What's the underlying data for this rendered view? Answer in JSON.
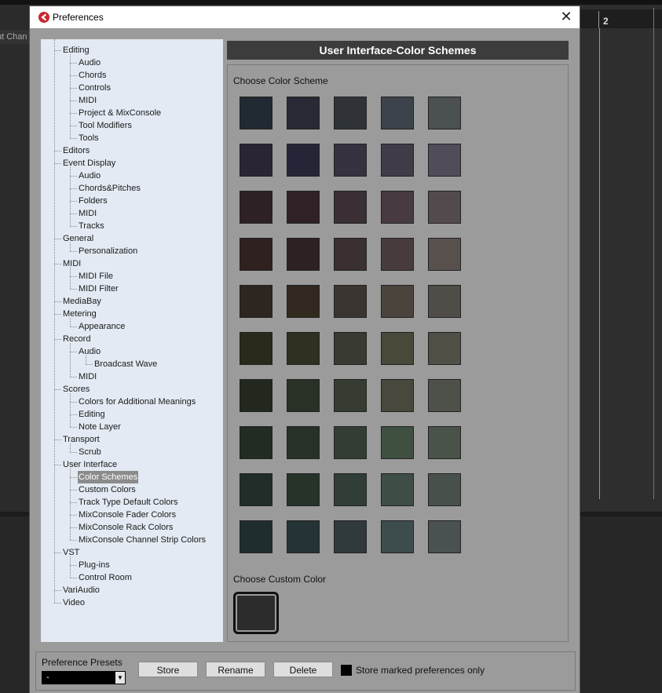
{
  "background": {
    "left_tab": "ut Chan",
    "ruler_number": "2"
  },
  "window": {
    "title": "Preferences",
    "close_glyph": "✕"
  },
  "tree": [
    {
      "label": "Editing"
    },
    {
      "label": "Audio"
    },
    {
      "label": "Chords"
    },
    {
      "label": "Controls"
    },
    {
      "label": "MIDI"
    },
    {
      "label": "Project & MixConsole"
    },
    {
      "label": "Tool Modifiers"
    },
    {
      "label": "Tools"
    },
    {
      "label": "Editors"
    },
    {
      "label": "Event Display"
    },
    {
      "label": "Audio"
    },
    {
      "label": "Chords&Pitches"
    },
    {
      "label": "Folders"
    },
    {
      "label": "MIDI"
    },
    {
      "label": "Tracks"
    },
    {
      "label": "General"
    },
    {
      "label": "Personalization"
    },
    {
      "label": "MIDI"
    },
    {
      "label": "MIDI File"
    },
    {
      "label": "MIDI Filter"
    },
    {
      "label": "MediaBay"
    },
    {
      "label": "Metering"
    },
    {
      "label": "Appearance"
    },
    {
      "label": "Record"
    },
    {
      "label": "Audio"
    },
    {
      "label": "Broadcast Wave"
    },
    {
      "label": "MIDI"
    },
    {
      "label": "Scores"
    },
    {
      "label": "Colors for Additional Meanings"
    },
    {
      "label": "Editing"
    },
    {
      "label": "Note Layer"
    },
    {
      "label": "Transport"
    },
    {
      "label": "Scrub"
    },
    {
      "label": "User Interface"
    },
    {
      "label": "Color Schemes"
    },
    {
      "label": "Custom Colors"
    },
    {
      "label": "Track Type Default Colors"
    },
    {
      "label": "MixConsole Fader Colors"
    },
    {
      "label": "MixConsole Rack Colors"
    },
    {
      "label": "MixConsole Channel Strip Colors"
    },
    {
      "label": "VST"
    },
    {
      "label": "Plug-ins"
    },
    {
      "label": "Control Room"
    },
    {
      "label": "VariAudio"
    },
    {
      "label": "Video"
    }
  ],
  "tree_selected_index": 34,
  "content": {
    "header": "User Interface-Color Schemes",
    "choose_scheme_label": "Choose Color Scheme",
    "choose_custom_label": "Choose Custom Color",
    "custom_color": "#2c2c2c",
    "swatches": [
      [
        "#212a33",
        "#272a34",
        "#2f3338",
        "#3c434b",
        "#4b5053"
      ],
      [
        "#2b2435",
        "#262537",
        "#363240",
        "#413b48",
        "#514c58"
      ],
      [
        "#2e2126",
        "#302126",
        "#3a2f34",
        "#483a41",
        "#534a4e"
      ],
      [
        "#2e2120",
        "#2e2121",
        "#3a302f",
        "#483d3c",
        "#57504d"
      ],
      [
        "#2d251f",
        "#312820",
        "#3a3530",
        "#4a443c",
        "#504c47"
      ],
      [
        "#29291c",
        "#2f2f22",
        "#393a32",
        "#49493a",
        "#4f4f46"
      ],
      [
        "#23281e",
        "#293025",
        "#363c32",
        "#48493c",
        "#4d5149"
      ],
      [
        "#222c22",
        "#283128",
        "#343d34",
        "#405040",
        "#495349"
      ],
      [
        "#212d28",
        "#253329",
        "#313e37",
        "#3e4d46",
        "#48504c"
      ],
      [
        "#202d2f",
        "#253336",
        "#30393c",
        "#3d4c4c",
        "#4a5153"
      ]
    ]
  },
  "bottom": {
    "presets_label": "Preference Presets",
    "preset_value": "-",
    "store_label": "Store",
    "rename_label": "Rename",
    "delete_label": "Delete",
    "store_marked_label": "Store marked preferences only"
  }
}
